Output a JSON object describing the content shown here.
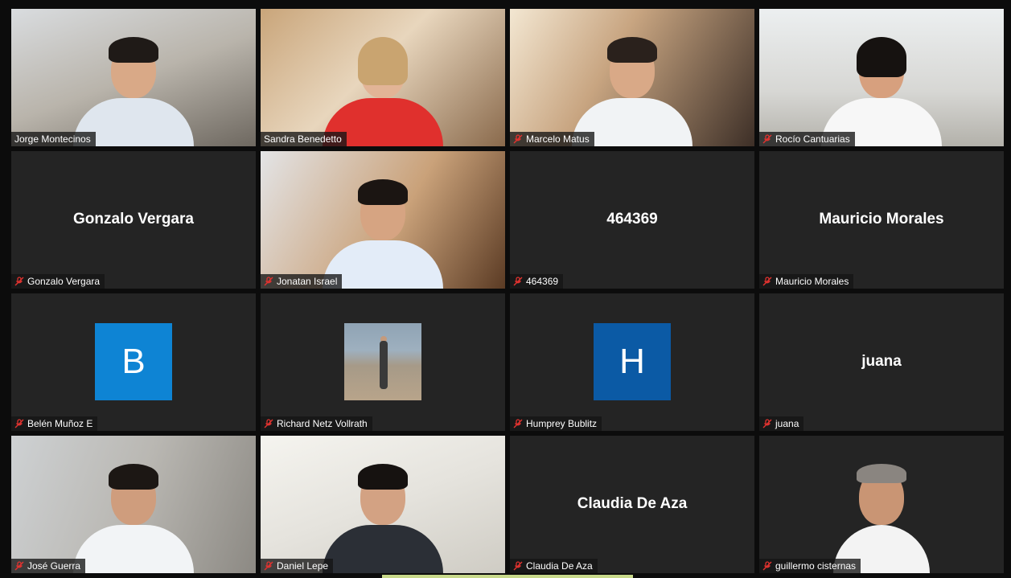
{
  "participants": [
    {
      "name": "Jorge Montecinos",
      "type": "video",
      "muted": false
    },
    {
      "name": "Sandra Benedetto",
      "type": "video",
      "muted": false
    },
    {
      "name": "Marcelo Matus",
      "type": "video",
      "muted": true
    },
    {
      "name": "Rocío Cantuarias",
      "type": "video",
      "muted": true
    },
    {
      "name": "Gonzalo Vergara",
      "type": "name",
      "display": "Gonzalo Vergara",
      "muted": true
    },
    {
      "name": "Jonatan Israel",
      "type": "video",
      "muted": true
    },
    {
      "name": "464369",
      "type": "name",
      "display": "464369",
      "muted": true
    },
    {
      "name": "Mauricio Morales",
      "type": "name",
      "display": "Mauricio Morales",
      "muted": true
    },
    {
      "name": "Belén Muñoz E",
      "type": "letter",
      "letter": "B",
      "color": "#0e84d4",
      "muted": true
    },
    {
      "name": "Richard Netz Vollrath",
      "type": "photo",
      "muted": true
    },
    {
      "name": "Humprey Bublitz",
      "type": "letter",
      "letter": "H",
      "color": "#0b5aa5",
      "muted": true
    },
    {
      "name": "juana",
      "type": "name",
      "display": "juana",
      "muted": true
    },
    {
      "name": "José Guerra",
      "type": "video",
      "muted": true
    },
    {
      "name": "Daniel Lepe",
      "type": "video",
      "muted": true
    },
    {
      "name": "Claudia De Aza",
      "type": "name",
      "display": "Claudia De Aza",
      "muted": true
    },
    {
      "name": "guillermo cisternas",
      "type": "video",
      "muted": true
    }
  ],
  "icons": {
    "muted": "mic-muted-icon"
  },
  "colors": {
    "muted_icon": "#e0322f",
    "active_speaker_bar": "#c8d98a"
  }
}
